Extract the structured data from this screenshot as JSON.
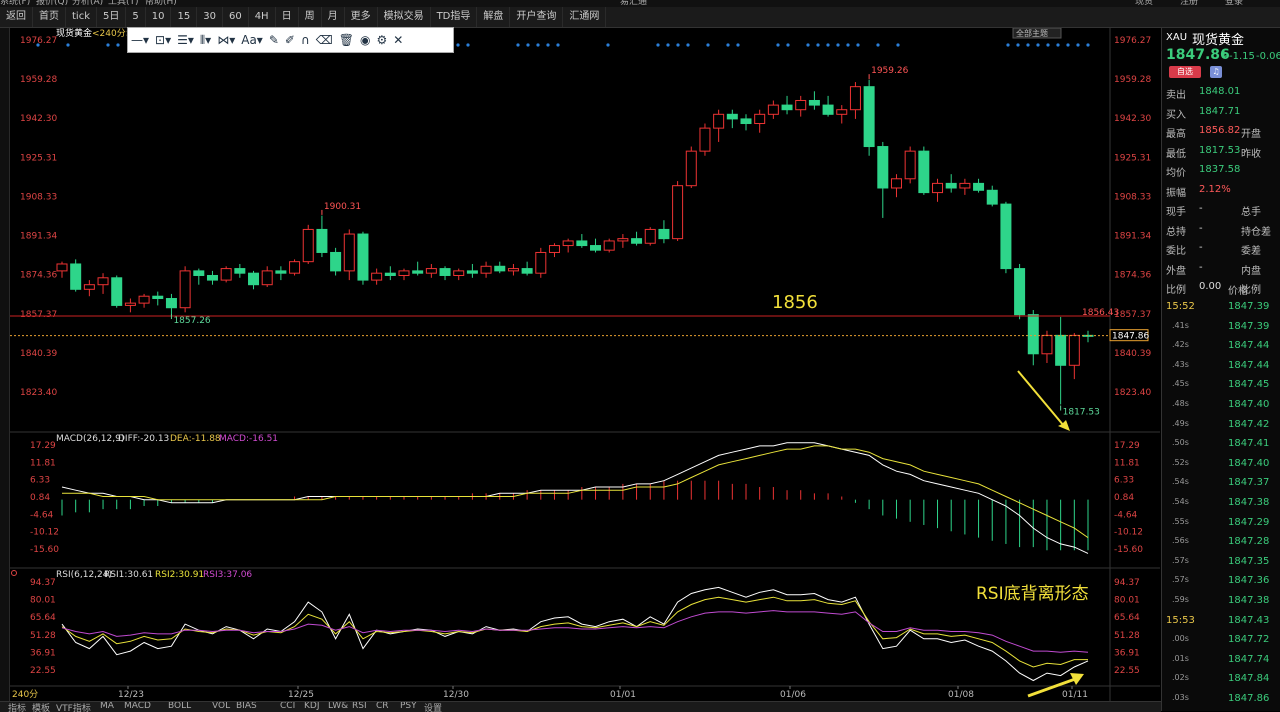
{
  "topbar": {
    "items": [
      "系统(F)",
      "报价(Q)",
      "分析(A)",
      "工具(T)",
      "帮助(H)",
      "易汇通",
      "现货",
      "注册",
      "登录"
    ]
  },
  "toolbar": {
    "items": [
      "返回",
      "首页",
      "tick",
      "5日",
      "5",
      "10",
      "15",
      "30",
      "60",
      "4H",
      "日",
      "周",
      "月",
      "更多",
      "模拟交易",
      "TD指导",
      "解盘",
      "开户查询",
      "汇通网"
    ]
  },
  "chart": {
    "title": "现货黄金",
    "period_badge": "<240分>",
    "layout_btn": "全部主题",
    "price_axis": [
      "1976.27",
      "1959.28",
      "1942.30",
      "1925.31",
      "1908.33",
      "1891.34",
      "1874.36",
      "1857.37",
      "1840.39",
      "1823.40"
    ],
    "annotations": {
      "high1": "1900.31",
      "high2": "1959.26",
      "low1": "1857.26",
      "low2": "1817.53",
      "level_label": "1856",
      "level_value": "1856.43",
      "current": "1847.86"
    },
    "macd_label": "MACD(26,12,9)",
    "macd_diff": "DIFF:-20.13",
    "macd_dea": "DEA:-11.88",
    "macd_macd": "MACD:-16.51",
    "macd_axis": [
      "17.29",
      "11.81",
      "6.33",
      "0.84",
      "-4.64",
      "-10.12",
      "-15.60"
    ],
    "rsi_label": "RSI(6,12,24)",
    "rsi1": "RSI1:30.61",
    "rsi2": "RSI2:30.91",
    "rsi3": "RSI3:37.06",
    "rsi_axis": [
      "94.37",
      "80.01",
      "65.64",
      "51.28",
      "36.91",
      "22.55"
    ],
    "rsi_note": "RSI底背离形态",
    "dates": [
      "12/23",
      "12/25",
      "12/30",
      "01/01",
      "01/06",
      "01/08",
      "01/11"
    ],
    "period_tag": "240分"
  },
  "quote": {
    "code": "XAU",
    "name": "现货黄金",
    "price": "1847.86",
    "arrow": "↓",
    "change": "-1.15",
    "pct": "-0.06",
    "tag": "自选",
    "fields": [
      {
        "l": "卖出",
        "v": "1848.01"
      },
      {
        "l": "买入",
        "v": "1847.71"
      },
      {
        "l": "最高",
        "v": "1856.82",
        "r": "开盘"
      },
      {
        "l": "最低",
        "v": "1817.53",
        "r": "昨收"
      },
      {
        "l": "均价",
        "v": "1837.58"
      },
      {
        "l": "振幅",
        "v": "2.12%"
      },
      {
        "l": "现手",
        "v": "-",
        "r": "总手"
      },
      {
        "l": "总持",
        "v": "-",
        "r": "持仓差"
      },
      {
        "l": "委比",
        "v": "-",
        "r": "委差"
      },
      {
        "l": "外盘",
        "v": "-",
        "r": "内盘"
      },
      {
        "l": "比例",
        "v": "0.00",
        "r": "比例"
      }
    ],
    "ticks_header": "价格",
    "ticks": [
      {
        "t": "15:52",
        "p": "1847.39"
      },
      {
        "t": ".41s",
        "p": "1847.39"
      },
      {
        "t": ".42s",
        "p": "1847.44"
      },
      {
        "t": ".43s",
        "p": "1847.44"
      },
      {
        "t": ".45s",
        "p": "1847.45"
      },
      {
        "t": ".48s",
        "p": "1847.40"
      },
      {
        "t": ".49s",
        "p": "1847.42"
      },
      {
        "t": ".50s",
        "p": "1847.41"
      },
      {
        "t": ".52s",
        "p": "1847.40"
      },
      {
        "t": ".54s",
        "p": "1847.37"
      },
      {
        "t": ".54s",
        "p": "1847.38"
      },
      {
        "t": ".55s",
        "p": "1847.29"
      },
      {
        "t": ".56s",
        "p": "1847.28"
      },
      {
        "t": ".57s",
        "p": "1847.35"
      },
      {
        "t": ".57s",
        "p": "1847.36"
      },
      {
        "t": ".59s",
        "p": "1847.38"
      },
      {
        "t": "15:53",
        "p": "1847.43"
      },
      {
        "t": ".00s",
        "p": "1847.72"
      },
      {
        "t": ".01s",
        "p": "1847.74"
      },
      {
        "t": ".02s",
        "p": "1847.84"
      },
      {
        "t": ".03s",
        "p": "1847.86"
      }
    ]
  },
  "bottombar": {
    "items": [
      "指标",
      "模板",
      "VTF指标",
      "MA",
      "MACD",
      "BOLL",
      "VOL",
      "BIAS",
      "CCI",
      "KDJ",
      "LW&",
      "RSI",
      "CR",
      "PSY",
      "设置"
    ]
  }
}
